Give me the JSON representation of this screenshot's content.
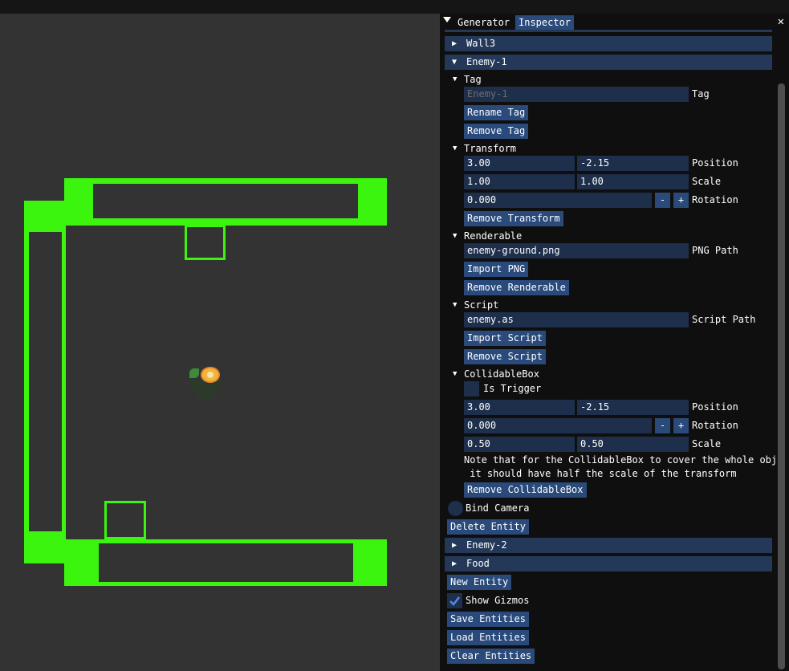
{
  "colors": {
    "gizmo": "#3cf50f",
    "header": "#24395a",
    "button": "#294a7a",
    "field": "#1d2f4b",
    "check": "#4e8bf0"
  },
  "tabs": [
    "Generator",
    "Inspector"
  ],
  "close_glyph": "✕",
  "entities": {
    "wall3": "Wall3",
    "enemy1": "Enemy-1",
    "enemy2": "Enemy-2",
    "food": "Food"
  },
  "tag": {
    "title": "Tag",
    "value": "Enemy-1",
    "label": "Tag",
    "rename": "Rename Tag",
    "remove": "Remove Tag"
  },
  "transform": {
    "title": "Transform",
    "pos_x": "3.00",
    "pos_y": "-2.15",
    "pos_label": "Position",
    "scale_x": "1.00",
    "scale_y": "1.00",
    "scale_label": "Scale",
    "rotation": "0.000",
    "rotation_label": "Rotation",
    "minus": "-",
    "plus": "+",
    "remove": "Remove Transform"
  },
  "renderable": {
    "title": "Renderable",
    "path": "enemy-ground.png",
    "path_label": "PNG Path",
    "import": "Import PNG",
    "remove": "Remove Renderable"
  },
  "script": {
    "title": "Script",
    "path": "enemy.as",
    "path_label": "Script Path",
    "import": "Import Script",
    "remove": "Remove Script"
  },
  "collidable": {
    "title": "CollidableBox",
    "trigger_label": "Is Trigger",
    "pos_x": "3.00",
    "pos_y": "-2.15",
    "pos_label": "Position",
    "rotation": "0.000",
    "rotation_label": "Rotation",
    "minus": "-",
    "plus": "+",
    "scale_x": "0.50",
    "scale_y": "0.50",
    "scale_label": "Scale",
    "note_line1": "Note that for the CollidableBox to cover the whole obje",
    "note_line2": " it should have half the scale of the transform",
    "remove": "Remove CollidableBox"
  },
  "bind_camera": "Bind Camera",
  "delete_entity": "Delete Entity",
  "new_entity": "New Entity",
  "show_gizmos": "Show Gizmos",
  "save_entities": "Save Entities",
  "load_entities": "Load Entities",
  "clear_entities": "Clear Entities",
  "arrows": {
    "collapsed": "▶",
    "expanded": "▼"
  }
}
